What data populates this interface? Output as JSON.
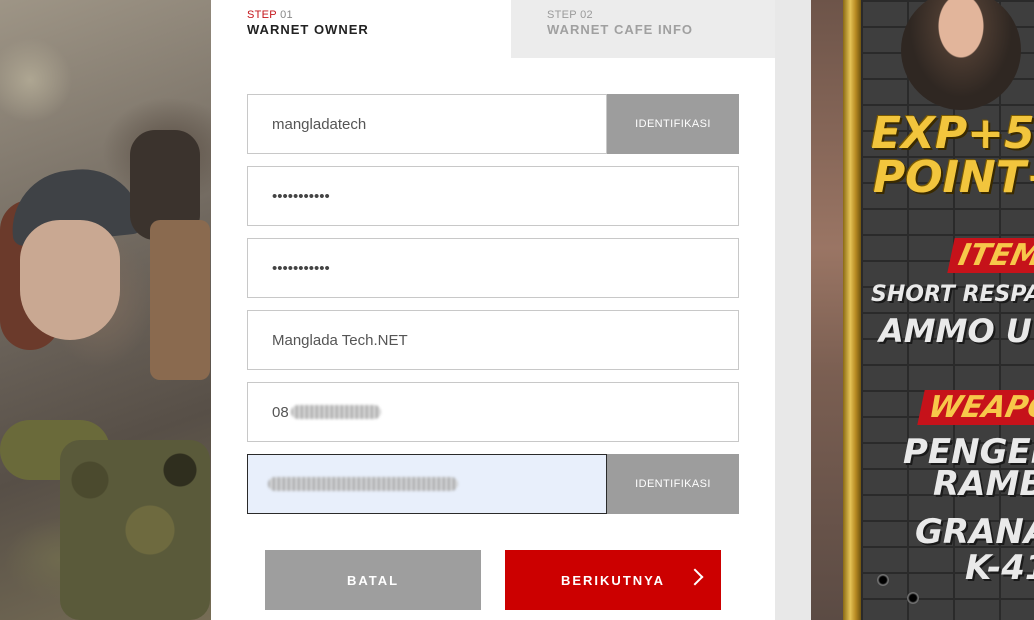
{
  "steps": [
    {
      "word": "STEP",
      "num": "01",
      "title": "WARNET OWNER",
      "active": true
    },
    {
      "word": "STEP",
      "num": "02",
      "title": "WARNET CAFE INFO",
      "active": false
    }
  ],
  "form": {
    "username": "mangladatech",
    "password": "•••••••••••",
    "password_confirm": "•••••••••••",
    "cafe_name": "Manglada Tech.NET",
    "phone_prefix": "08",
    "identify_label": "IDENTIFIKASI"
  },
  "actions": {
    "cancel": "BATAL",
    "next": "BERIKUTNYA"
  },
  "promo": {
    "line1": "EXP+5",
    "line2": "POINT+",
    "items": "ITEMS",
    "short_resp": "SHORT RESPA",
    "ammo": "AMMO U",
    "weapon": "WEAPO",
    "penger": "PENGER",
    "ramb": "RAMB",
    "grana": "GRANA",
    "k41": "K-41"
  },
  "colors": {
    "accent_red": "#cc0000",
    "button_gray": "#9e9e9e",
    "focus_bg": "#e8effb"
  }
}
